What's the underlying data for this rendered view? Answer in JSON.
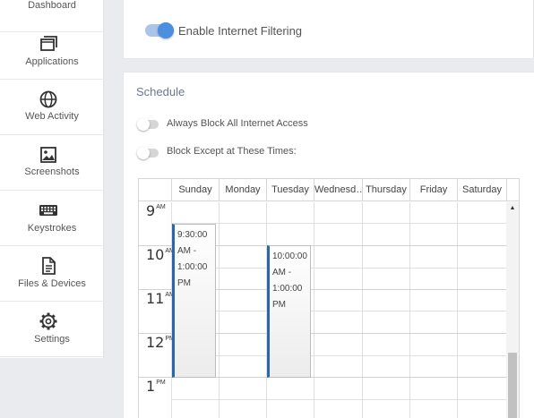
{
  "sidebar": {
    "items": [
      {
        "label": "Dashboard",
        "icon": "dashboard-icon"
      },
      {
        "label": "Applications",
        "icon": "applications-icon"
      },
      {
        "label": "Web Activity",
        "icon": "globe-icon"
      },
      {
        "label": "Screenshots",
        "icon": "image-icon"
      },
      {
        "label": "Keystrokes",
        "icon": "keyboard-icon"
      },
      {
        "label": "Files & Devices",
        "icon": "file-icon"
      },
      {
        "label": "Settings",
        "icon": "gear-icon"
      }
    ]
  },
  "filtering": {
    "label": "Enable Internet Filtering",
    "enabled": true
  },
  "schedule": {
    "title": "Schedule",
    "options": [
      {
        "label": "Always Block All Internet Access",
        "enabled": false
      },
      {
        "label": "Block Except at These Times:",
        "enabled": false
      }
    ],
    "days": [
      "Sunday",
      "Monday",
      "Tuesday",
      "Wednesd…",
      "Thursday",
      "Friday",
      "Saturday"
    ],
    "hours": [
      {
        "num": "9",
        "suffix": "AM"
      },
      {
        "num": "10",
        "suffix": "AM"
      },
      {
        "num": "11",
        "suffix": "AM"
      },
      {
        "num": "12",
        "suffix": "PM"
      },
      {
        "num": "1",
        "suffix": "PM"
      }
    ],
    "events": [
      {
        "day": "Sunday",
        "line1": "9:30:00",
        "line2": "AM -",
        "line3": "1:00:00",
        "line4": "PM"
      },
      {
        "day": "Tuesday",
        "line1": "10:00:00",
        "line2": "AM -",
        "line3": "1:00:00",
        "line4": "PM"
      }
    ]
  },
  "colors": {
    "accent": "#4a8fe0",
    "event_border": "#2a67a9",
    "background": "#e9ebee"
  }
}
